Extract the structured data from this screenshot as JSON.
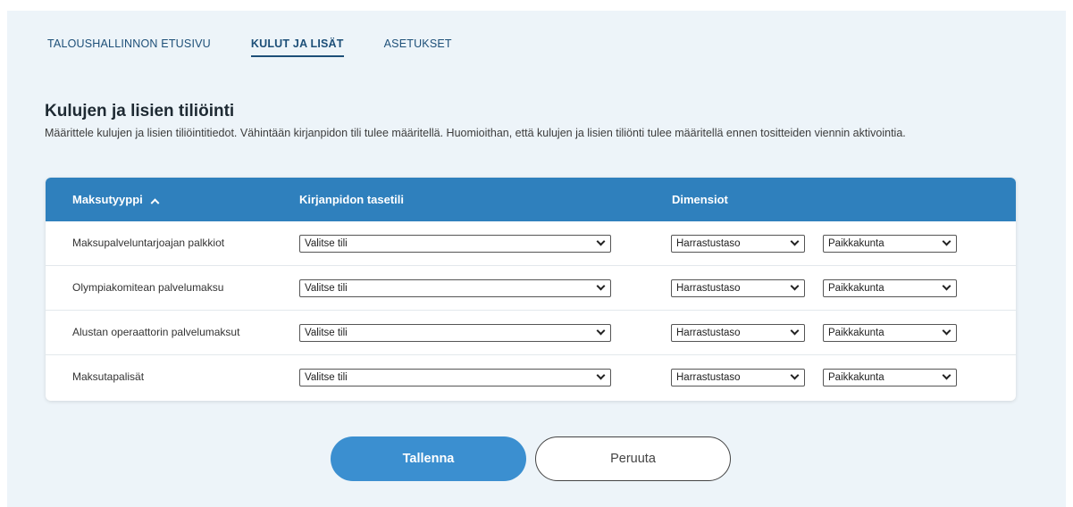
{
  "tabs": [
    {
      "label": "TALOUSHALLINNON ETUSIVU",
      "active": false
    },
    {
      "label": "KULUT JA LISÄT",
      "active": true
    },
    {
      "label": "ASETUKSET",
      "active": false
    }
  ],
  "heading": {
    "title": "Kulujen ja lisien tiliöinti",
    "description": "Määrittele kulujen ja lisien tiliöintitiedot. Vähintään kirjanpidon tili tulee määritellä. Huomioithan, että kulujen ja lisien tiliönti tulee määritellä ennen tositteiden viennin aktivointia."
  },
  "table": {
    "columns": {
      "payment_type": "Maksutyyppi",
      "balance_account": "Kirjanpidon tasetili",
      "dimensions": "Dimensiot"
    },
    "sort_icon": "chevron-up-icon",
    "rows": [
      {
        "label": "Maksupalveluntarjoajan palkkiot",
        "account": "Valitse tili",
        "dim1": "Harrastustaso",
        "dim2": "Paikkakunta"
      },
      {
        "label": "Olympiakomitean palvelumaksu",
        "account": "Valitse tili",
        "dim1": "Harrastustaso",
        "dim2": "Paikkakunta"
      },
      {
        "label": "Alustan operaattorin palvelumaksut",
        "account": "Valitse tili",
        "dim1": "Harrastustaso",
        "dim2": "Paikkakunta"
      },
      {
        "label": "Maksutapalisät",
        "account": "Valitse tili",
        "dim1": "Harrastustaso",
        "dim2": "Paikkakunta"
      }
    ]
  },
  "buttons": {
    "save": "Tallenna",
    "cancel": "Peruuta"
  },
  "colors": {
    "page_bg": "#edf4f9",
    "header_bg": "#2f80bd",
    "primary_button": "#3b8fd0",
    "tab_text": "#1d4f78"
  }
}
